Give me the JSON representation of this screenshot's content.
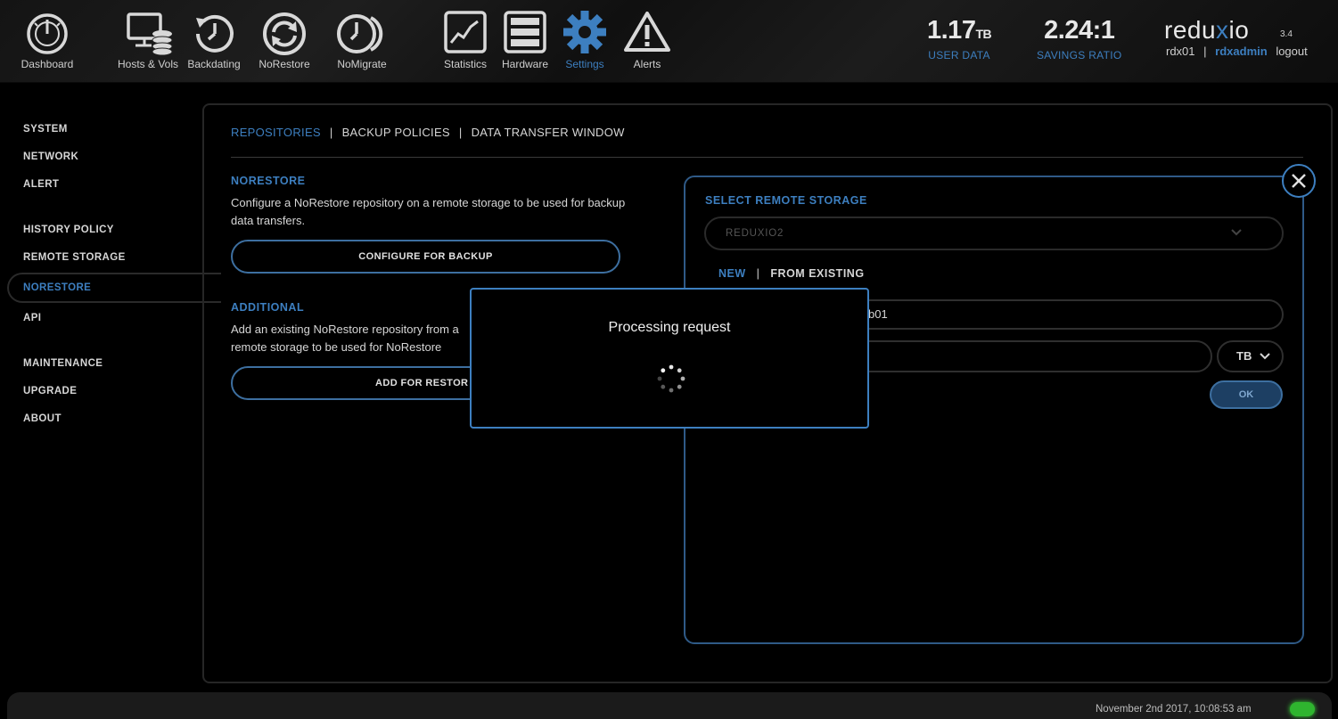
{
  "nav": {
    "items": [
      {
        "label": "Dashboard",
        "icon": "gauge-icon"
      },
      {
        "label": "Hosts & Vols",
        "icon": "monitor-db-icon"
      },
      {
        "label": "Backdating",
        "icon": "history-clock-icon"
      },
      {
        "label": "NoRestore",
        "icon": "sync-arrows-icon"
      },
      {
        "label": "NoMigrate",
        "icon": "migrate-clock-icon"
      },
      {
        "label": "Statistics",
        "icon": "line-chart-icon"
      },
      {
        "label": "Hardware",
        "icon": "server-rack-icon"
      },
      {
        "label": "Settings",
        "icon": "gear-icon"
      },
      {
        "label": "Alerts",
        "icon": "warning-icon"
      }
    ],
    "active": "Settings"
  },
  "stats": {
    "user_data_value": "1.17",
    "user_data_unit": "TB",
    "user_data_label": "USER DATA",
    "savings_value": "2.24:1",
    "savings_label": "SAVINGS RATIO"
  },
  "brand": {
    "name_left": "redu",
    "name_x": "x",
    "name_right": "io",
    "version": "3.4",
    "system": "rdx01",
    "separator": "|",
    "user": "rdxadmin",
    "logout": "logout"
  },
  "sidebar": {
    "items": [
      {
        "label": "SYSTEM"
      },
      {
        "label": "NETWORK"
      },
      {
        "label": "ALERT"
      },
      {
        "label": "HISTORY POLICY"
      },
      {
        "label": "REMOTE STORAGE"
      },
      {
        "label": "NORESTORE"
      },
      {
        "label": "API"
      },
      {
        "label": "MAINTENANCE"
      },
      {
        "label": "UPGRADE"
      },
      {
        "label": "ABOUT"
      }
    ],
    "active": "NORESTORE"
  },
  "tabs": {
    "items": [
      "REPOSITORIES",
      "BACKUP POLICIES",
      "DATA TRANSFER WINDOW"
    ],
    "separator": "|",
    "active": "REPOSITORIES"
  },
  "norestore_section": {
    "title": "NORESTORE",
    "description": "Configure a NoRestore repository on a remote storage to be used for backup data transfers.",
    "button": "CONFIGURE FOR BACKUP"
  },
  "additional_section": {
    "title": "ADDITIONAL",
    "description": "Add an existing NoRestore repository from a remote storage to be used for NoRestore",
    "button": "ADD FOR RESTOR"
  },
  "remote_panel": {
    "title": "SELECT REMOTE STORAGE",
    "selected_storage": "REDUXIO2",
    "subtab_new": "NEW",
    "subtab_existing": "FROM EXISTING",
    "subtab_sep": "|",
    "subtab_active": "NEW",
    "name_value": "b01",
    "size_value": "",
    "unit": "TB",
    "ok": "OK"
  },
  "modal": {
    "title": "Processing request"
  },
  "footer": {
    "timestamp": "November 2nd 2017, 10:08:53 am"
  },
  "colors": {
    "accent": "#3d7fc0",
    "status_ok": "#2fb52f"
  }
}
